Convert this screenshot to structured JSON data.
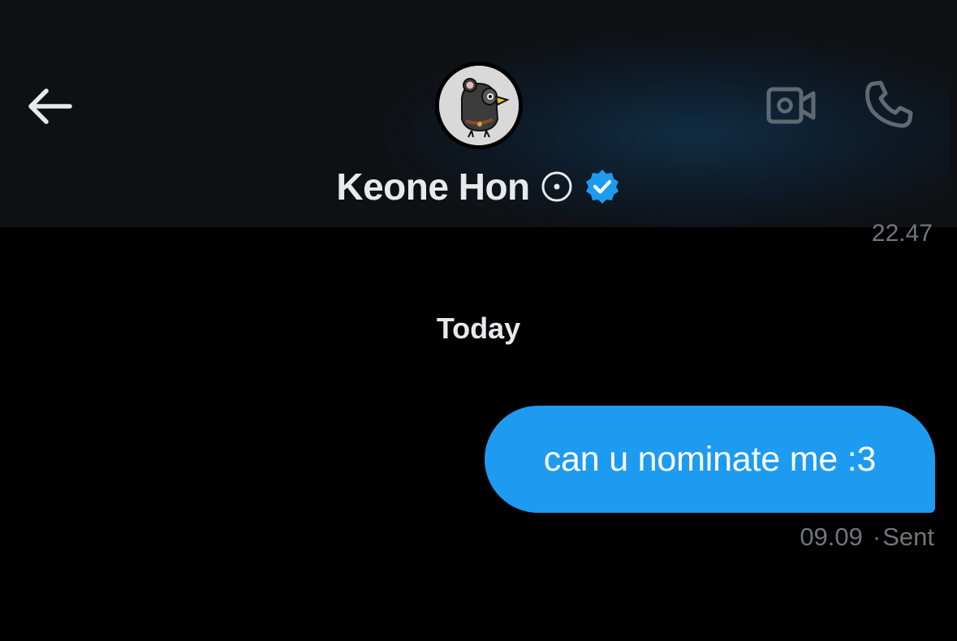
{
  "header": {
    "contact_name": "Keone Hon",
    "icons": {
      "back": "arrow-left-icon",
      "status": "circle-dot-icon",
      "verified": "verified-badge-icon",
      "video": "video-camera-icon",
      "call": "phone-icon"
    }
  },
  "chat": {
    "previous_timestamp": "22.47",
    "day_divider": "Today",
    "messages": [
      {
        "direction": "outgoing",
        "text": "can u nominate me :3",
        "time": "09.09",
        "status": "Sent"
      }
    ]
  },
  "colors": {
    "background": "#000000",
    "header_background": "#0f1013",
    "outgoing_bubble": "#1d9bf0",
    "verified_blue": "#1d9bf0",
    "muted_text": "#71767b",
    "primary_text": "#e7e9ea"
  }
}
